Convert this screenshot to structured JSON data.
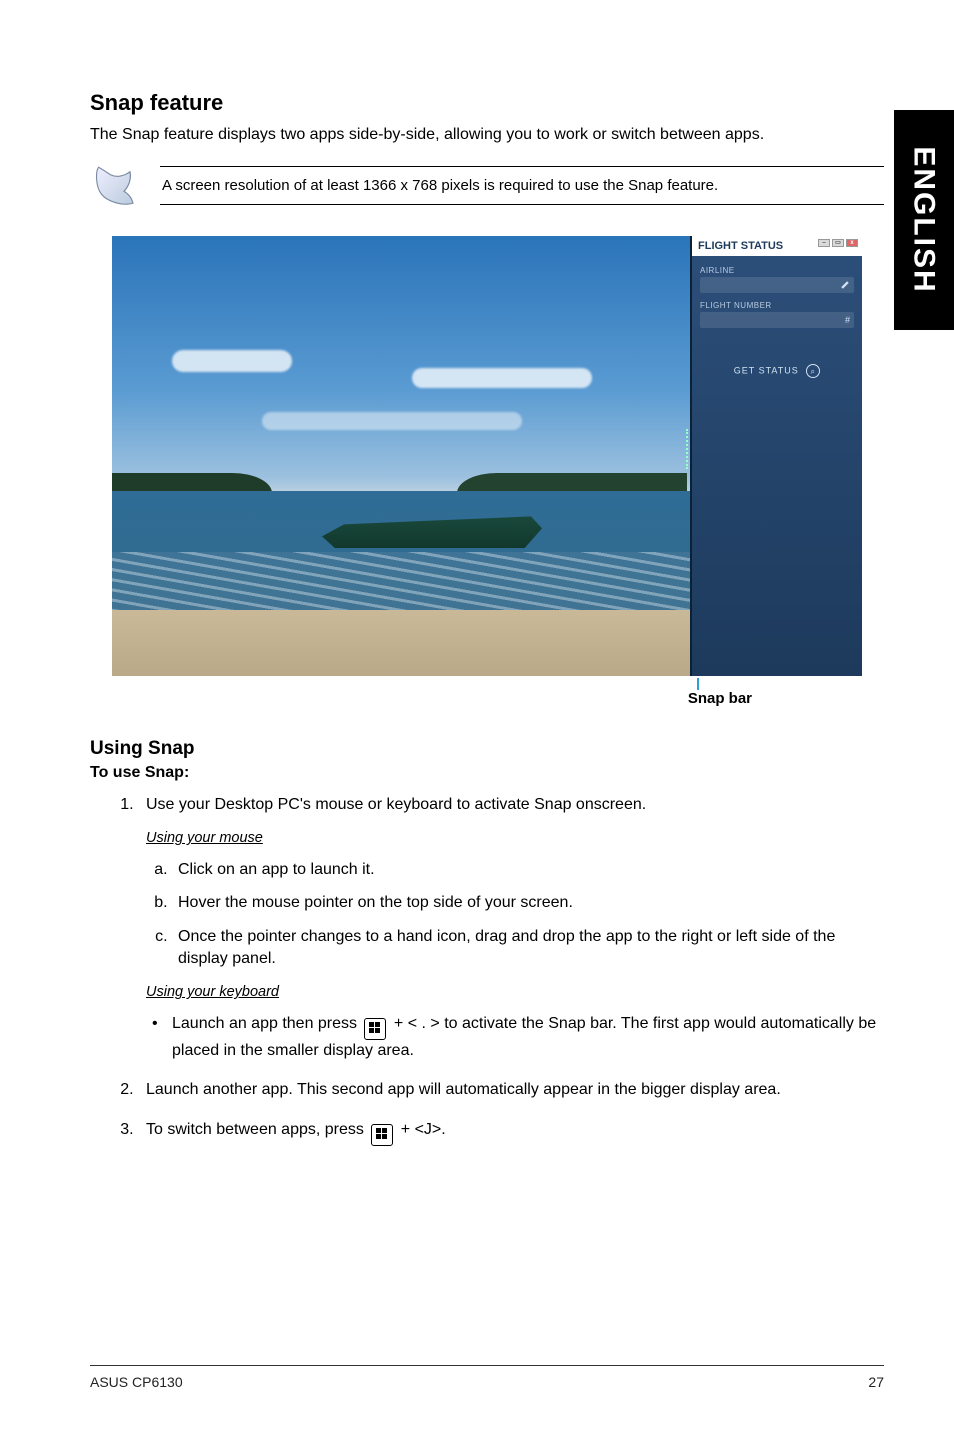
{
  "side_tab": "ENGLISH",
  "h_snap_feature": "Snap feature",
  "p_intro": "The Snap feature displays two apps side-by-side, allowing you to work or switch between apps.",
  "note_text": "A screen resolution of at least 1366 x 768 pixels is required to use the Snap feature.",
  "screenshot": {
    "panel_title": "FLIGHT STATUS",
    "lbl_airline": "AIRLINE",
    "lbl_flightnum": "FLIGHT NUMBER",
    "flightnum_placeholder": "#",
    "btn_get_status": "GET STATUS",
    "caption": "Snap bar"
  },
  "h_using_snap": "Using Snap",
  "h_to_use": "To use Snap:",
  "step1": "Use your Desktop PC's mouse or keyboard to activate Snap onscreen.",
  "sub_mouse": "Using your mouse",
  "mouse_a": "Click on an app to launch it.",
  "mouse_b": "Hover the mouse pointer on the top side of your screen.",
  "mouse_c": "Once the pointer changes to a hand icon, drag and drop the app to the right or left side of the display panel.",
  "sub_keyboard": "Using your keyboard",
  "kb_pre": "Launch an app then press ",
  "kb_mid": " + < . > to activate the Snap bar. The first app would automatically be placed in the smaller display area.",
  "step2": "Launch another app. This second app will automatically appear in the bigger display area.",
  "step3_pre": "To switch between apps, press ",
  "step3_post": " + <J>.",
  "footer_left": "ASUS CP6130",
  "footer_right": "27"
}
